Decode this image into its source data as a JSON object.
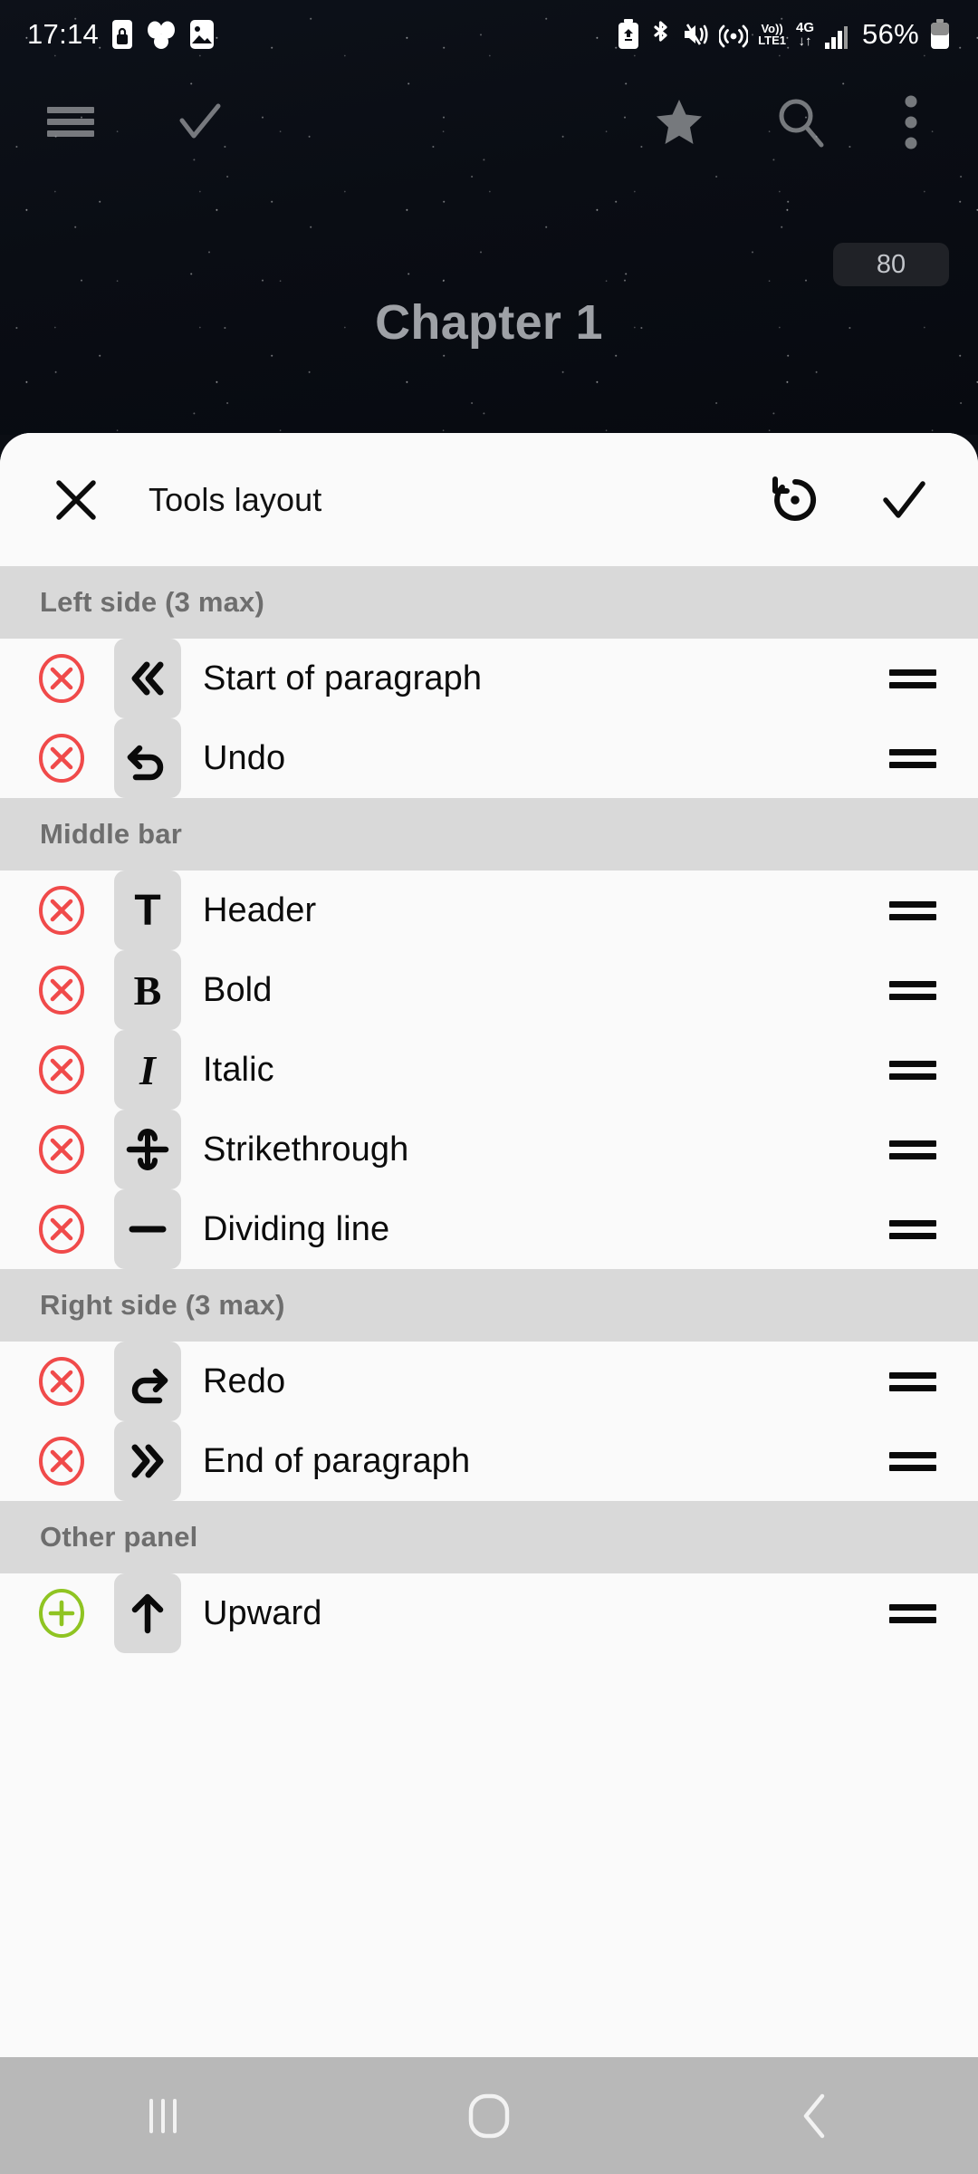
{
  "status_bar": {
    "time": "17:14",
    "left_icons": [
      "phone-lock-icon",
      "samsung-cloud-icon",
      "gallery-icon"
    ],
    "right_icons": [
      "battery-saver-icon",
      "bluetooth-icon",
      "mute-vibrate-icon",
      "hotspot-icon"
    ],
    "volte_label_top": "Vo))",
    "volte_label_bottom": "LTE1",
    "network_type": "4G",
    "data_arrows": "↓↑",
    "signal_icon": "signal-bars-icon",
    "battery_percent": "56%"
  },
  "app_bar": {
    "menu_icon": "hamburger-menu-icon",
    "check_icon": "check-icon",
    "star_icon": "star-icon",
    "search_icon": "search-icon",
    "overflow_icon": "more-vertical-icon"
  },
  "reader": {
    "chapter_title": "Chapter 1",
    "page_badge": "80"
  },
  "sheet": {
    "close_label": "close-icon",
    "title": "Tools layout",
    "reset_label": "restore-default-icon",
    "confirm_label": "confirm-check-icon"
  },
  "sections": [
    {
      "title": "Left side (3 max)",
      "rows": [
        {
          "action": "remove",
          "icon": "chevron-double-left-icon",
          "glyph": "«",
          "label": "Start of paragraph"
        },
        {
          "action": "remove",
          "icon": "undo-arrow-icon",
          "glyph": "↶",
          "label": "Undo"
        }
      ]
    },
    {
      "title": "Middle bar",
      "rows": [
        {
          "action": "remove",
          "icon": "header-text-icon",
          "glyph": "T",
          "label": "Header"
        },
        {
          "action": "remove",
          "icon": "bold-icon",
          "glyph": "B",
          "label": "Bold"
        },
        {
          "action": "remove",
          "icon": "italic-icon",
          "glyph": "I",
          "label": "Italic"
        },
        {
          "action": "remove",
          "icon": "strikethrough-icon",
          "glyph": "⊖",
          "label": "Strikethrough"
        },
        {
          "action": "remove",
          "icon": "dividing-line-icon",
          "glyph": "—",
          "label": "Dividing line"
        }
      ]
    },
    {
      "title": "Right side (3 max)",
      "rows": [
        {
          "action": "remove",
          "icon": "redo-arrow-icon",
          "glyph": "↷",
          "label": "Redo"
        },
        {
          "action": "remove",
          "icon": "chevron-double-right-icon",
          "glyph": "»",
          "label": "End of paragraph"
        }
      ]
    },
    {
      "title": "Other panel",
      "rows": [
        {
          "action": "add",
          "icon": "arrow-upward-icon",
          "glyph": "↑",
          "label": "Upward"
        }
      ]
    }
  ],
  "nav_bar": {
    "recents_icon": "recents-icon",
    "home_icon": "home-icon",
    "back_icon": "back-icon"
  },
  "colors": {
    "remove_red": "#f04a4a",
    "add_green": "#8fc422",
    "section_header_bg": "#d9d9d9",
    "sheet_bg": "#fafafa",
    "nav_bg": "#b8b8b8",
    "title_gray": "#9ea1a6"
  }
}
